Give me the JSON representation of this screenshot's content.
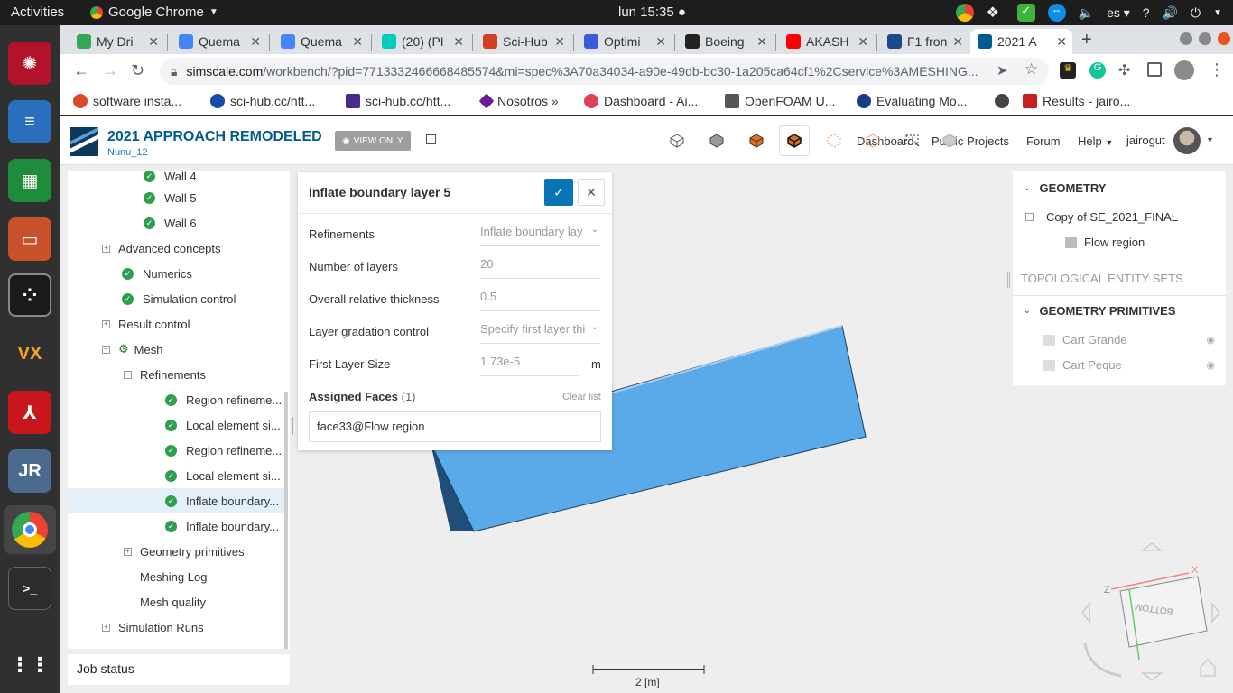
{
  "os": {
    "activities": "Activities",
    "app_name": "Google Chrome",
    "clock": "lun 15:35 ●",
    "language": "es ▾"
  },
  "chrome": {
    "tabs": [
      {
        "title": "My Dri",
        "color": "#34a853"
      },
      {
        "title": "Quema",
        "color": "#4285f4"
      },
      {
        "title": "Quema",
        "color": "#4285f4"
      },
      {
        "title": "(20) (PI",
        "color": "#00ccbb"
      },
      {
        "title": "Sci-Hub",
        "color": "#d04020"
      },
      {
        "title": "Optimi",
        "color": "#3a5bd9"
      },
      {
        "title": "Boeing",
        "color": "#222222"
      },
      {
        "title": "AKASH",
        "color": "#ff0000"
      },
      {
        "title": "F1 fron",
        "color": "#1a4a8a"
      },
      {
        "title": "2021 A",
        "color": "#005b8f"
      }
    ],
    "url_domain": "simscale.com",
    "url_rest": "/workbench/?pid=7713332466668485574&mi=spec%3A70a34034-a90e-49db-bc30-1a205ca64cf1%2Cservice%3AMESHING...",
    "bookmarks": [
      {
        "label": "software insta...",
        "color": "#d94a2b"
      },
      {
        "label": "sci-hub.cc/htt...",
        "color": "#1a4aa8"
      },
      {
        "label": "sci-hub.cc/htt...",
        "color": "#4a2a8a"
      },
      {
        "label": "Nosotros »",
        "color": "#6a1a9a"
      },
      {
        "label": "Dashboard - Ai...",
        "color": "#e0405a"
      },
      {
        "label": "OpenFOAM U...",
        "color": "#555555"
      },
      {
        "label": "Evaluating Mo...",
        "color": "#1a3a8a"
      },
      {
        "label": "",
        "color": "#444444"
      },
      {
        "label": "Results - jairo...",
        "color": "#c5221f"
      }
    ]
  },
  "header": {
    "project_title": "2021 APPROACH REMODELED",
    "project_owner": "Nunu_12",
    "view_only": "VIEW ONLY",
    "nav": {
      "dashboard": "Dashboard",
      "public_projects": "Public Projects",
      "forum": "Forum",
      "help": "Help",
      "user": "jairogut"
    }
  },
  "tree": {
    "nodes": [
      {
        "label": "Wall 4",
        "status": "check"
      },
      {
        "label": "Wall 5",
        "status": "check"
      },
      {
        "label": "Wall 6",
        "status": "check"
      },
      {
        "label": "Advanced concepts",
        "status": "expand"
      },
      {
        "label": "Numerics",
        "status": "check"
      },
      {
        "label": "Simulation control",
        "status": "check"
      },
      {
        "label": "Result control",
        "status": "expand"
      },
      {
        "label": "Mesh",
        "status": "mesh"
      },
      {
        "label": "Refinements",
        "status": "collapse"
      },
      {
        "label": "Region refineme...",
        "status": "check"
      },
      {
        "label": "Local element si...",
        "status": "check"
      },
      {
        "label": "Region refineme...",
        "status": "check"
      },
      {
        "label": "Local element si...",
        "status": "check"
      },
      {
        "label": "Inflate boundary...",
        "status": "check"
      },
      {
        "label": "Inflate boundary...",
        "status": "check"
      },
      {
        "label": "Geometry primitives",
        "status": "expand"
      },
      {
        "label": "Meshing Log",
        "status": "none"
      },
      {
        "label": "Mesh quality",
        "status": "none"
      },
      {
        "label": "Simulation Runs",
        "status": "expand"
      }
    ],
    "job_status": "Job status"
  },
  "dialog": {
    "title": "Inflate boundary layer 5",
    "rows": [
      {
        "label": "Refinements",
        "value": "Inflate boundary lay",
        "dropdown": true
      },
      {
        "label": "Number of layers",
        "value": "20"
      },
      {
        "label": "Overall relative thickness",
        "value": "0.5"
      },
      {
        "label": "Layer gradation control",
        "value": "Specify first layer thi",
        "dropdown": true
      },
      {
        "label": "First Layer Size",
        "value": "1.73e-5",
        "unit": "m"
      }
    ],
    "assigned_faces_label": "Assigned Faces",
    "assigned_faces_count": "(1)",
    "clear_list": "Clear list",
    "face_item": "face33@Flow region"
  },
  "viewport": {
    "scale_label": "2 [m]",
    "gizmo": {
      "x": "X",
      "z": "Z",
      "face": "BOTTOM"
    }
  },
  "right_panel": {
    "geometry_heading": "GEOMETRY",
    "geometry_root": "Copy of SE_2021_FINAL",
    "geometry_child": "Flow region",
    "topological_heading": "TOPOLOGICAL ENTITY SETS",
    "primitives_heading": "GEOMETRY PRIMITIVES",
    "primitives": [
      "Cart Grande",
      "Cart Peque"
    ]
  }
}
